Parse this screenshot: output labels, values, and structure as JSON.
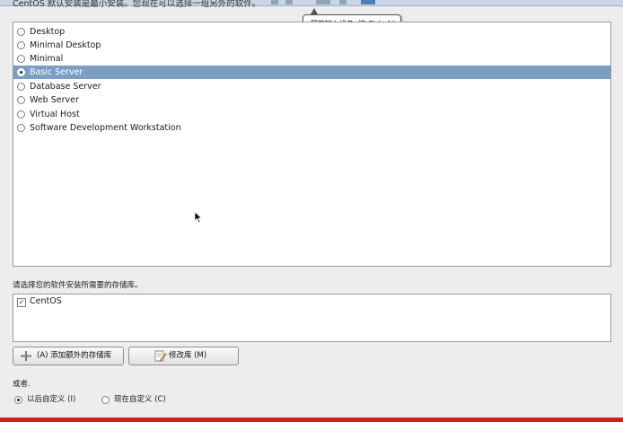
{
  "header": {
    "text": "CentOS 默认安装是最小安装。您现在可以选择一组另外的软件。"
  },
  "tooltip": {
    "text": "释放输入设备, 按 Ctrl+Alt."
  },
  "install_options": [
    {
      "label": "Desktop",
      "selected": false
    },
    {
      "label": "Minimal Desktop",
      "selected": false
    },
    {
      "label": "Minimal",
      "selected": false
    },
    {
      "label": "Basic Server",
      "selected": true
    },
    {
      "label": "Database Server",
      "selected": false
    },
    {
      "label": "Web Server",
      "selected": false
    },
    {
      "label": "Virtual Host",
      "selected": false
    },
    {
      "label": "Software Development Workstation",
      "selected": false
    }
  ],
  "repos": {
    "prompt": "请选择您的软件安装所需要的存储库。",
    "items": [
      {
        "label": "CentOS",
        "checked": true
      }
    ]
  },
  "buttons": {
    "add_repo": "(A) 添加额外的存储库",
    "modify_repo": "修改库 (M)"
  },
  "customize": {
    "or_label": "或者.",
    "later_label": "以后自定义 (I)",
    "now_label": "现在自定义 (C)",
    "selected": "later"
  },
  "colors": {
    "selection": "#7a9ec4",
    "bottom_bar": "#d21d1d"
  }
}
